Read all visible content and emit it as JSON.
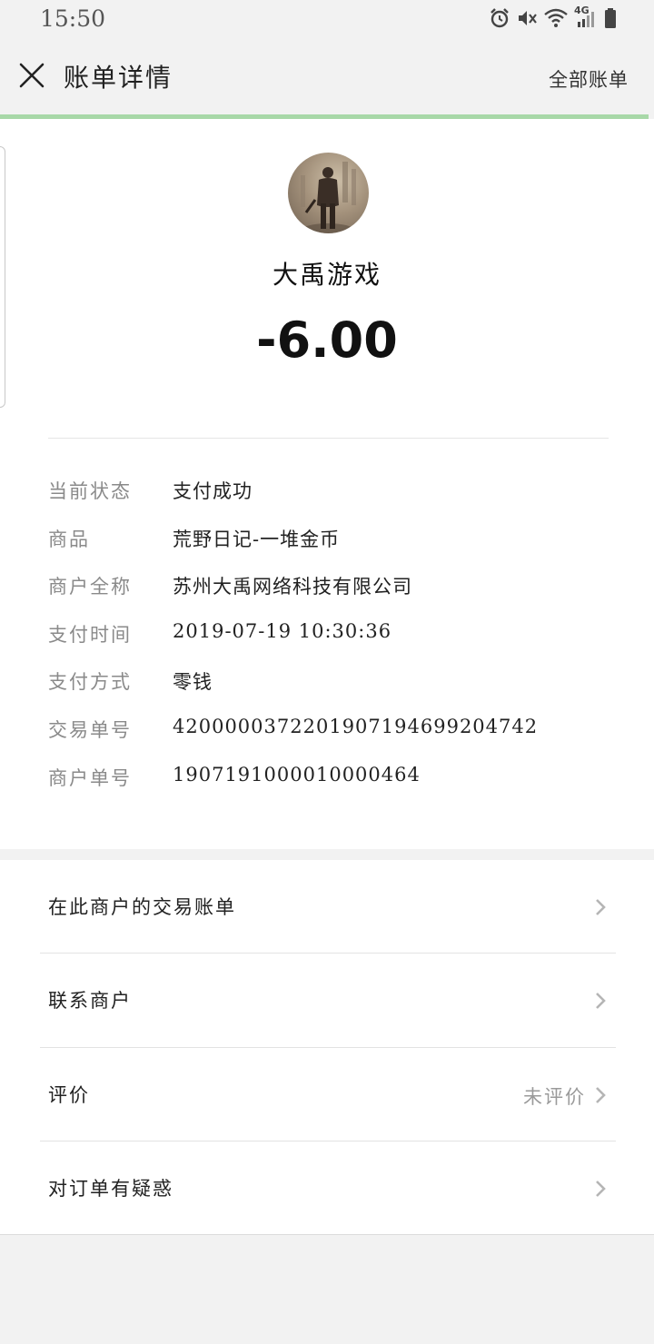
{
  "status_bar": {
    "time": "15:50",
    "network_label": "4G",
    "icons": [
      "alarm-icon",
      "mute-icon",
      "wifi-icon",
      "signal-icon",
      "battery-icon"
    ]
  },
  "nav": {
    "title": "账单详情",
    "right_link": "全部账单",
    "close_icon": "close-icon",
    "progress_color": "#a8d8a8"
  },
  "header": {
    "merchant_name": "大禹游戏",
    "amount": "-6.00"
  },
  "details": [
    {
      "label": "当前状态",
      "value": "支付成功"
    },
    {
      "label": "商品",
      "value": "荒野日记-一堆金币"
    },
    {
      "label": "商户全称",
      "value": "苏州大禹网络科技有限公司"
    },
    {
      "label": "支付时间",
      "value": "2019-07-19 10:30:36"
    },
    {
      "label": "支付方式",
      "value": "零钱"
    },
    {
      "label": "交易单号",
      "value": "4200000372201907194699204742"
    },
    {
      "label": "商户单号",
      "value": "1907191000010000464"
    }
  ],
  "menu": [
    {
      "label": "在此商户的交易账单",
      "sub": ""
    },
    {
      "label": "联系商户",
      "sub": ""
    },
    {
      "label": "评价",
      "sub": "未评价"
    },
    {
      "label": "对订单有疑惑",
      "sub": ""
    }
  ]
}
